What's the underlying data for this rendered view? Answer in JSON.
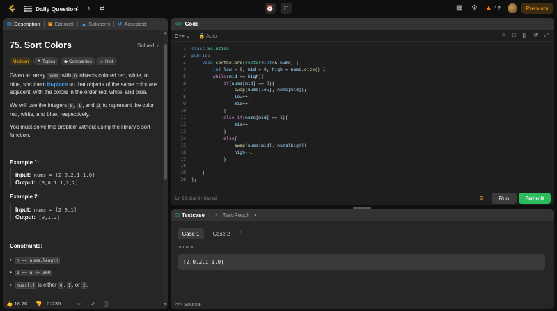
{
  "topbar": {
    "title": "Daily Question",
    "streak": "12",
    "premium": "Premium"
  },
  "tabs": [
    {
      "label": "Description",
      "icon": "document-icon"
    },
    {
      "label": "Editorial",
      "icon": "book-icon"
    },
    {
      "label": "Solutions",
      "icon": "flask-icon"
    },
    {
      "label": "Accepted",
      "icon": "history-icon"
    }
  ],
  "problem": {
    "title": "75. Sort Colors",
    "status": "Solved",
    "chips": {
      "difficulty": "Medium",
      "topics": "Topics",
      "companies": "Companies",
      "hint": "Hint"
    },
    "p1_a": "Given an array ",
    "p1_code1": "nums",
    "p1_b": " with ",
    "p1_code2": "n",
    "p1_c": " objects colored red, white, or",
    "p1_d": "blue, sort them ",
    "p1_hl": "in-place",
    "p1_e": " so that objects of the same color are",
    "p1_f": "adjacent, with the colors in the order red, white, and blue.",
    "p2_a": "We will use the integers ",
    "p2_c0": "0",
    "p2_sep1": ", ",
    "p2_c1": "1",
    "p2_b": ", and ",
    "p2_c2": "2",
    "p2_c": " to represent the color",
    "p2_d": "red, white, and blue, respectively.",
    "p3_a": "You must solve this problem without using the library's sort",
    "p3_b": "function.",
    "ex1": {
      "heading": "Example 1:",
      "input_label": "Input:",
      "input": "nums = [2,0,2,1,1,0]",
      "output_label": "Output:",
      "output": "[0,0,1,1,2,2]"
    },
    "ex2": {
      "heading": "Example 2:",
      "input_label": "Input:",
      "input": "nums = [2,0,1]",
      "output_label": "Output:",
      "output": "[0,1,2]"
    },
    "constraints_heading": "Constraints:",
    "c1": "n == nums.length",
    "c2": "1 <= n <= 300",
    "c3_code": "nums[i]",
    "c3_a": " is either ",
    "c3_v0": "0",
    "c3_sep": ", ",
    "c3_v1": "1",
    "c3_or": ", or ",
    "c3_v2": "2",
    "c3_end": "."
  },
  "footer_left": {
    "likes": "18.2K",
    "comments": "236"
  },
  "code_panel": {
    "title": "Code",
    "language": "C++",
    "mode": "Auto",
    "status_pos": "Ln 20, Col 3",
    "status_saved": "Saved",
    "run": "Run",
    "submit": "Submit"
  },
  "testcase": {
    "tab1": "Testcase",
    "tab2": "Test Result",
    "case1": "Case 1",
    "case2": "Case 2",
    "input_label": "nums =",
    "input_value": "[2,0,2,1,1,0]",
    "source": "Source"
  },
  "colors": {
    "accent": "#ffa116",
    "green": "#2cbb5d",
    "blue_link": "#3ea6ff"
  }
}
